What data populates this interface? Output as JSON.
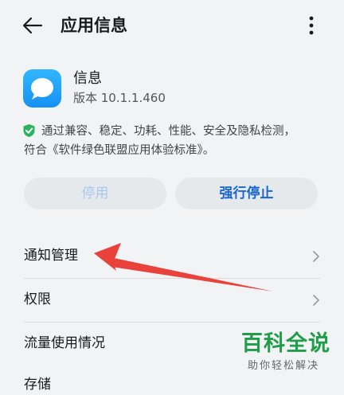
{
  "header": {
    "title": "应用信息",
    "back_icon": "back-arrow-icon",
    "more_icon": "more-vertical-icon"
  },
  "app": {
    "name": "信息",
    "version": "版本 10.1.1.460",
    "icon": "message-bubble-icon",
    "icon_color": "#1e9cf7"
  },
  "notice": {
    "icon": "shield-check-icon",
    "text": "通过兼容、稳定、功耗、性能、安全及隐私检测，符合《软件绿色联盟应用体验标准》。"
  },
  "buttons": {
    "disable": "停用",
    "force_stop": "强行停止"
  },
  "list": [
    {
      "label": "通知管理",
      "chevron": true
    },
    {
      "label": "权限",
      "chevron": true
    },
    {
      "label": "流量使用情况",
      "chevron": false
    }
  ],
  "partial_row": "存储",
  "watermark": {
    "logo": "百科全说",
    "sub": "助你轻松解决"
  },
  "colors": {
    "accent": "#1a66d1",
    "background": "#f1f3f5",
    "arrow": "#e8423b",
    "watermark": "#1f9d48"
  }
}
